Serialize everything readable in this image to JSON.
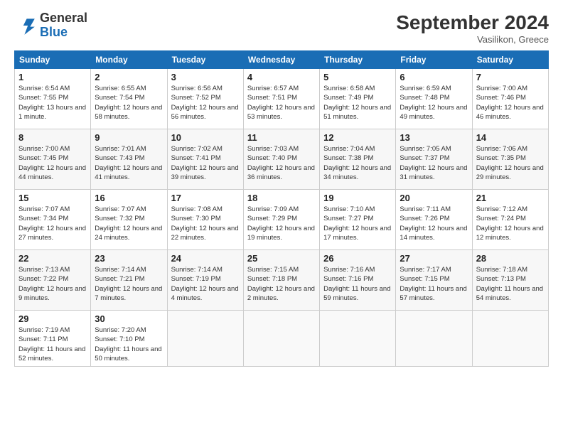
{
  "header": {
    "logo_text_general": "General",
    "logo_text_blue": "Blue",
    "month_year": "September 2024",
    "location": "Vasilikon, Greece"
  },
  "days_of_week": [
    "Sunday",
    "Monday",
    "Tuesday",
    "Wednesday",
    "Thursday",
    "Friday",
    "Saturday"
  ],
  "weeks": [
    [
      {
        "num": "1",
        "sunrise": "6:54 AM",
        "sunset": "7:55 PM",
        "daylight": "13 hours and 1 minute."
      },
      {
        "num": "2",
        "sunrise": "6:55 AM",
        "sunset": "7:54 PM",
        "daylight": "12 hours and 58 minutes."
      },
      {
        "num": "3",
        "sunrise": "6:56 AM",
        "sunset": "7:52 PM",
        "daylight": "12 hours and 56 minutes."
      },
      {
        "num": "4",
        "sunrise": "6:57 AM",
        "sunset": "7:51 PM",
        "daylight": "12 hours and 53 minutes."
      },
      {
        "num": "5",
        "sunrise": "6:58 AM",
        "sunset": "7:49 PM",
        "daylight": "12 hours and 51 minutes."
      },
      {
        "num": "6",
        "sunrise": "6:59 AM",
        "sunset": "7:48 PM",
        "daylight": "12 hours and 49 minutes."
      },
      {
        "num": "7",
        "sunrise": "7:00 AM",
        "sunset": "7:46 PM",
        "daylight": "12 hours and 46 minutes."
      }
    ],
    [
      {
        "num": "8",
        "sunrise": "7:00 AM",
        "sunset": "7:45 PM",
        "daylight": "12 hours and 44 minutes."
      },
      {
        "num": "9",
        "sunrise": "7:01 AM",
        "sunset": "7:43 PM",
        "daylight": "12 hours and 41 minutes."
      },
      {
        "num": "10",
        "sunrise": "7:02 AM",
        "sunset": "7:41 PM",
        "daylight": "12 hours and 39 minutes."
      },
      {
        "num": "11",
        "sunrise": "7:03 AM",
        "sunset": "7:40 PM",
        "daylight": "12 hours and 36 minutes."
      },
      {
        "num": "12",
        "sunrise": "7:04 AM",
        "sunset": "7:38 PM",
        "daylight": "12 hours and 34 minutes."
      },
      {
        "num": "13",
        "sunrise": "7:05 AM",
        "sunset": "7:37 PM",
        "daylight": "12 hours and 31 minutes."
      },
      {
        "num": "14",
        "sunrise": "7:06 AM",
        "sunset": "7:35 PM",
        "daylight": "12 hours and 29 minutes."
      }
    ],
    [
      {
        "num": "15",
        "sunrise": "7:07 AM",
        "sunset": "7:34 PM",
        "daylight": "12 hours and 27 minutes."
      },
      {
        "num": "16",
        "sunrise": "7:07 AM",
        "sunset": "7:32 PM",
        "daylight": "12 hours and 24 minutes."
      },
      {
        "num": "17",
        "sunrise": "7:08 AM",
        "sunset": "7:30 PM",
        "daylight": "12 hours and 22 minutes."
      },
      {
        "num": "18",
        "sunrise": "7:09 AM",
        "sunset": "7:29 PM",
        "daylight": "12 hours and 19 minutes."
      },
      {
        "num": "19",
        "sunrise": "7:10 AM",
        "sunset": "7:27 PM",
        "daylight": "12 hours and 17 minutes."
      },
      {
        "num": "20",
        "sunrise": "7:11 AM",
        "sunset": "7:26 PM",
        "daylight": "12 hours and 14 minutes."
      },
      {
        "num": "21",
        "sunrise": "7:12 AM",
        "sunset": "7:24 PM",
        "daylight": "12 hours and 12 minutes."
      }
    ],
    [
      {
        "num": "22",
        "sunrise": "7:13 AM",
        "sunset": "7:22 PM",
        "daylight": "12 hours and 9 minutes."
      },
      {
        "num": "23",
        "sunrise": "7:14 AM",
        "sunset": "7:21 PM",
        "daylight": "12 hours and 7 minutes."
      },
      {
        "num": "24",
        "sunrise": "7:14 AM",
        "sunset": "7:19 PM",
        "daylight": "12 hours and 4 minutes."
      },
      {
        "num": "25",
        "sunrise": "7:15 AM",
        "sunset": "7:18 PM",
        "daylight": "12 hours and 2 minutes."
      },
      {
        "num": "26",
        "sunrise": "7:16 AM",
        "sunset": "7:16 PM",
        "daylight": "11 hours and 59 minutes."
      },
      {
        "num": "27",
        "sunrise": "7:17 AM",
        "sunset": "7:15 PM",
        "daylight": "11 hours and 57 minutes."
      },
      {
        "num": "28",
        "sunrise": "7:18 AM",
        "sunset": "7:13 PM",
        "daylight": "11 hours and 54 minutes."
      }
    ],
    [
      {
        "num": "29",
        "sunrise": "7:19 AM",
        "sunset": "7:11 PM",
        "daylight": "11 hours and 52 minutes."
      },
      {
        "num": "30",
        "sunrise": "7:20 AM",
        "sunset": "7:10 PM",
        "daylight": "11 hours and 50 minutes."
      },
      null,
      null,
      null,
      null,
      null
    ]
  ]
}
